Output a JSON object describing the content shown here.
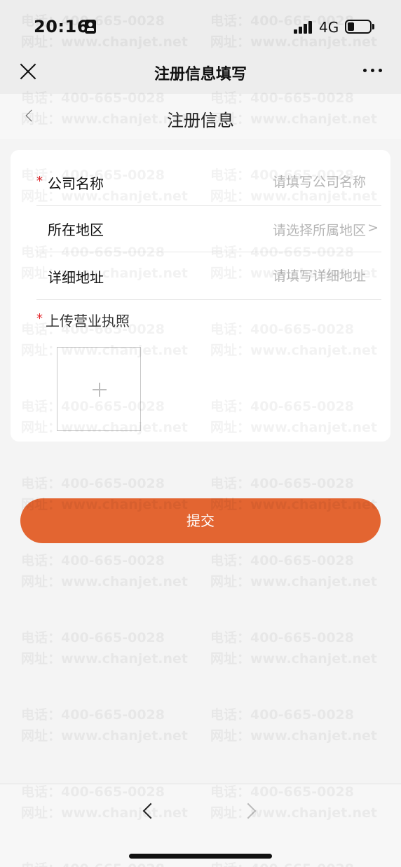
{
  "status_bar": {
    "time": "20:16",
    "network": "4G"
  },
  "nav_bar": {
    "title": "注册信息填写"
  },
  "sub_header": {
    "title": "注册信息"
  },
  "form": {
    "company_name": {
      "label": "公司名称",
      "placeholder": "请填写公司名称",
      "required": true
    },
    "region": {
      "label": "所在地区",
      "placeholder": "请选择所属地区",
      "chevron": ">"
    },
    "address": {
      "label": "详细地址",
      "placeholder": "请填写详细地址"
    },
    "license": {
      "label": "上传营业执照",
      "required": true
    },
    "required_mark": "*"
  },
  "submit": {
    "label": "提交"
  },
  "watermark": {
    "phone": "电话：400-665-0028",
    "site": "网址：www.chanjet.net"
  },
  "colors": {
    "accent": "#e36531",
    "required": "#e4262b",
    "page_bg": "#f4f4f4"
  }
}
